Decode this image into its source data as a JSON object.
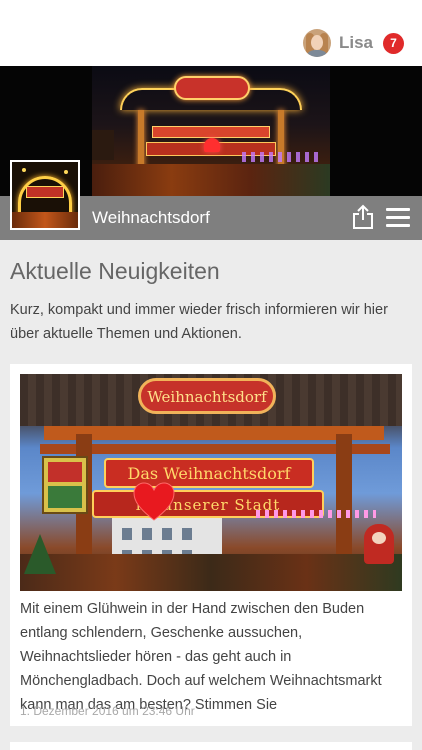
{
  "topbar": {
    "user_name": "Lisa",
    "notification_count": "7",
    "badge_color": "#e02a2a"
  },
  "header": {
    "page_title": "Weihnachtsdorf",
    "title_bar_color": "#7f7f7f",
    "icons": [
      "share-icon",
      "hamburger-menu-icon"
    ]
  },
  "main": {
    "section_title": "Aktuelle Neuigkeiten",
    "intro_text": "Kurz, kompakt und immer wieder frisch informieren wir hier über aktuelle Themen und Aktionen.",
    "news": [
      {
        "image_sign_top": "Weihnachtsdorf",
        "image_banner_1": "Das Weihnachtsdorf",
        "image_banner_2": "im           unserer Stadt",
        "excerpt": "Mit einem Glühwein in der Hand zwischen den Buden entlang schlendern, Geschenke aussuchen, Weihnachtslieder hören - das geht auch in Mönchengladbach. Doch auf welchem Weihnachtsmarkt kann man das am besten? Stimmen Sie",
        "date": "1. Dezember 2016 um 23:46 Uhr"
      }
    ]
  }
}
